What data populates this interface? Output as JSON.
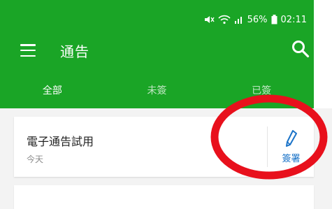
{
  "status_bar": {
    "battery_percent": "56%",
    "time": "02:11",
    "icons": [
      "mute-icon",
      "wifi-icon",
      "signal-icon",
      "battery-icon"
    ]
  },
  "header": {
    "title": "通告",
    "menu_icon": "menu-icon",
    "search_icon": "search-icon"
  },
  "tabs": [
    {
      "label": "全部",
      "active": true
    },
    {
      "label": "未簽",
      "active": false
    },
    {
      "label": "已簽",
      "active": false
    }
  ],
  "notices": [
    {
      "title": "電子通告試用",
      "date": "今天",
      "action_label": "簽署",
      "action_icon": "pen-icon"
    }
  ],
  "colors": {
    "header_green": "#1aa526",
    "action_blue": "#1a73c8",
    "annotation_red": "#e8101c"
  }
}
